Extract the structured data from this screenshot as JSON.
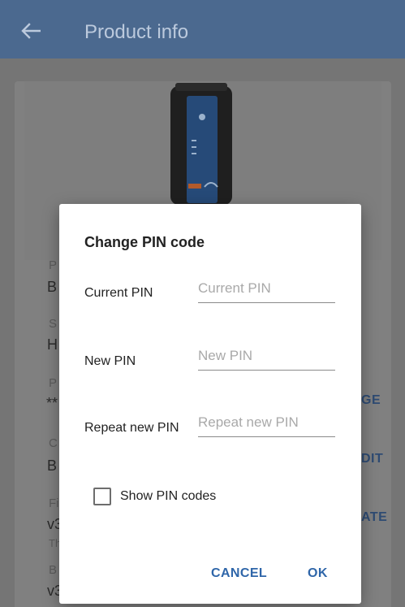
{
  "header": {
    "title": "Product info"
  },
  "background": {
    "left_letters": [
      "P",
      "B",
      "S",
      "H",
      "P",
      "**",
      "C",
      "B",
      "Fi",
      "v3",
      "Th",
      "B",
      "v3"
    ],
    "right_actions": [
      "GE",
      "DIT",
      "ATE"
    ]
  },
  "dialog": {
    "title": "Change PIN code",
    "fields": [
      {
        "label": "Current PIN",
        "placeholder": "Current PIN",
        "value": ""
      },
      {
        "label": "New PIN",
        "placeholder": "New PIN",
        "value": ""
      },
      {
        "label": "Repeat new PIN",
        "placeholder": "Repeat new PIN",
        "value": ""
      }
    ],
    "checkbox": {
      "label": "Show PIN codes",
      "checked": false
    },
    "buttons": {
      "cancel": "CANCEL",
      "ok": "OK"
    }
  },
  "icons": {
    "back": "arrow-left-icon"
  },
  "colors": {
    "appbar": "#4b698f",
    "accent": "#2f66a9"
  }
}
